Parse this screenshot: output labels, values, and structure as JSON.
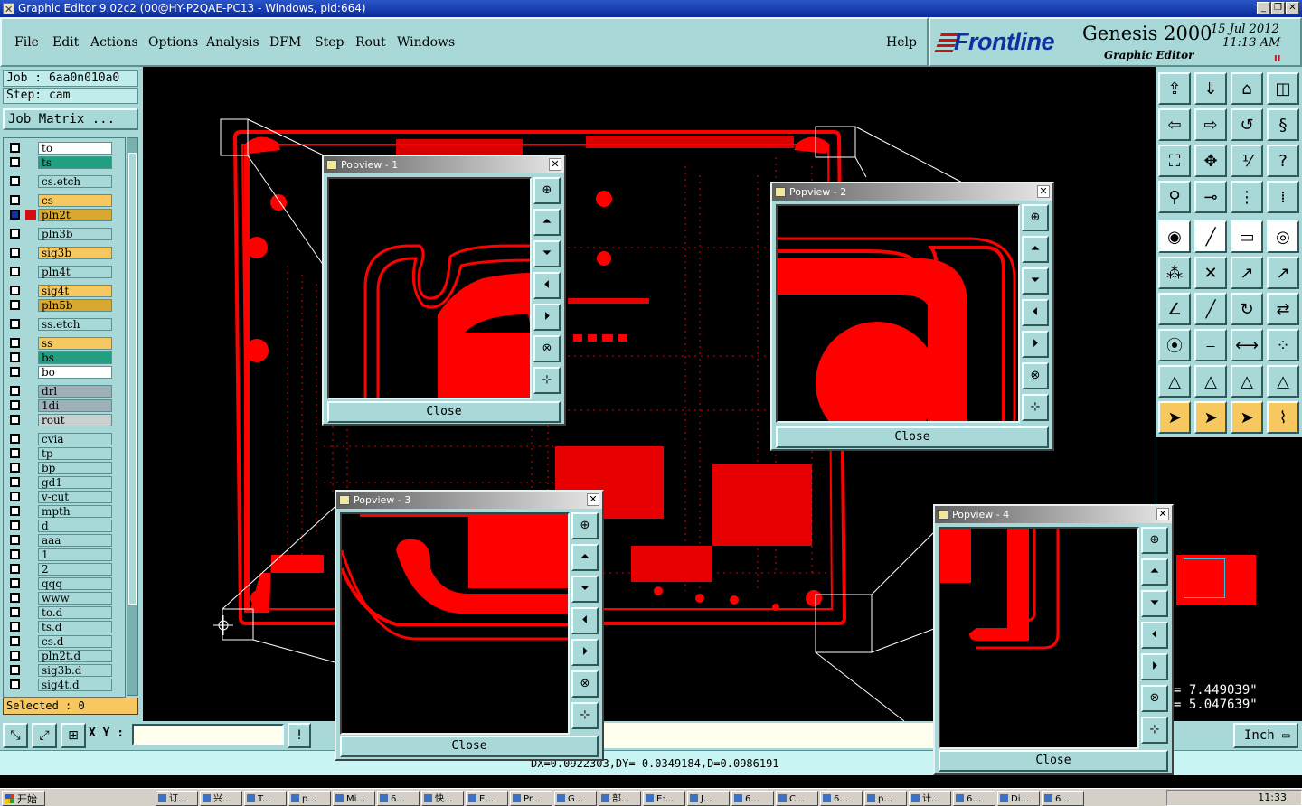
{
  "window": {
    "title": "Graphic Editor 9.02c2 (00@HY-P2QAE-PC13 - Windows, pid:664)",
    "min_label": "_",
    "restore_label": "❐",
    "close_label": "✕"
  },
  "menu": [
    {
      "label": "File"
    },
    {
      "label": "Edit"
    },
    {
      "label": "Actions"
    },
    {
      "label": "Options"
    },
    {
      "label": "Analysis"
    },
    {
      "label": "DFM"
    },
    {
      "label": "Step"
    },
    {
      "label": "Rout"
    },
    {
      "label": "Windows"
    },
    {
      "label": "Help"
    }
  ],
  "brand": {
    "logo": "Frontline",
    "product": "Genesis 2000",
    "subtitle": "Graphic Editor",
    "date": "15 Jul 2012",
    "time": "11:13 AM",
    "pause_glyph": "II"
  },
  "job": {
    "job_line": "Job : 6aa0n010a0",
    "step_line": "Step: cam",
    "matrix_button": "Job Matrix ..."
  },
  "layers": [
    {
      "name": "to",
      "color": "#ffffff",
      "on": false
    },
    {
      "name": "ts",
      "color": "#20a080",
      "on": false
    },
    {
      "name": "cs.etch",
      "color": "#a8d8d8",
      "on": false
    },
    {
      "name": "cs",
      "color": "#f8c860",
      "on": false
    },
    {
      "name": "pln2t",
      "color": "#d8a830",
      "on": true
    },
    {
      "name": "pln3b",
      "color": "#a8d8d8",
      "on": false
    },
    {
      "name": "sig3b",
      "color": "#f8c860",
      "on": false
    },
    {
      "name": "pln4t",
      "color": "#a8d8d8",
      "on": false
    },
    {
      "name": "sig4t",
      "color": "#f8c860",
      "on": false
    },
    {
      "name": "pln5b",
      "color": "#d8a830",
      "on": false
    },
    {
      "name": "ss.etch",
      "color": "#a8d8d8",
      "on": false
    },
    {
      "name": "ss",
      "color": "#f8c860",
      "on": false
    },
    {
      "name": "bs",
      "color": "#20a080",
      "on": false
    },
    {
      "name": "bo",
      "color": "#ffffff",
      "on": false
    },
    {
      "name": "drl",
      "color": "#a0b0b8",
      "on": false
    },
    {
      "name": "1di",
      "color": "#a0b0b8",
      "on": false
    },
    {
      "name": "rout",
      "color": "#c8d0d0",
      "on": false
    },
    {
      "name": "cvia",
      "color": "#a8d8d8",
      "on": false
    },
    {
      "name": "tp",
      "color": "#a8d8d8",
      "on": false
    },
    {
      "name": "bp",
      "color": "#a8d8d8",
      "on": false
    },
    {
      "name": "gd1",
      "color": "#a8d8d8",
      "on": false
    },
    {
      "name": "v-cut",
      "color": "#a8d8d8",
      "on": false
    },
    {
      "name": "mpth",
      "color": "#a8d8d8",
      "on": false
    },
    {
      "name": "d",
      "color": "#a8d8d8",
      "on": false
    },
    {
      "name": "aaa",
      "color": "#a8d8d8",
      "on": false
    },
    {
      "name": "1",
      "color": "#a8d8d8",
      "on": false
    },
    {
      "name": "2",
      "color": "#a8d8d8",
      "on": false
    },
    {
      "name": "qqq",
      "color": "#a8d8d8",
      "on": false
    },
    {
      "name": "www",
      "color": "#a8d8d8",
      "on": false
    },
    {
      "name": "to.d",
      "color": "#a8d8d8",
      "on": false
    },
    {
      "name": "ts.d",
      "color": "#a8d8d8",
      "on": false
    },
    {
      "name": "cs.d",
      "color": "#a8d8d8",
      "on": false
    },
    {
      "name": "pln2t.d",
      "color": "#a8d8d8",
      "on": false
    },
    {
      "name": "sig3b.d",
      "color": "#a8d8d8",
      "on": false
    },
    {
      "name": "sig4t.d",
      "color": "#a8d8d8",
      "on": false
    }
  ],
  "selected_label": "Selected : 0",
  "xy_label": "X Y :",
  "xy_value": "",
  "coords": {
    "x": "= 7.449039\"",
    "y": "= 5.047639\""
  },
  "unit": "Inch",
  "status": "DX=0.0922303,DY=-0.0349184,D=0.0986191",
  "popviews": [
    {
      "title": "Popview - 1",
      "close": "Close"
    },
    {
      "title": "Popview - 2",
      "close": "Close"
    },
    {
      "title": "Popview - 3",
      "close": "Close"
    },
    {
      "title": "Popview - 4",
      "close": "Close"
    }
  ],
  "taskbar": {
    "start": "开始",
    "tasks": [
      "订...",
      "兴...",
      "T...",
      "p...",
      "Mi...",
      "6...",
      "快...",
      "E...",
      "Pr...",
      "G...",
      "部...",
      "E:...",
      "J...",
      "6...",
      "C...",
      "6...",
      "p...",
      "计...",
      "6...",
      "Di...",
      "6..."
    ],
    "clock": "11:33"
  },
  "colors": {
    "panel": "#a8d8d8",
    "copper": "#ff0000",
    "accent_yellow": "#f8c860"
  }
}
